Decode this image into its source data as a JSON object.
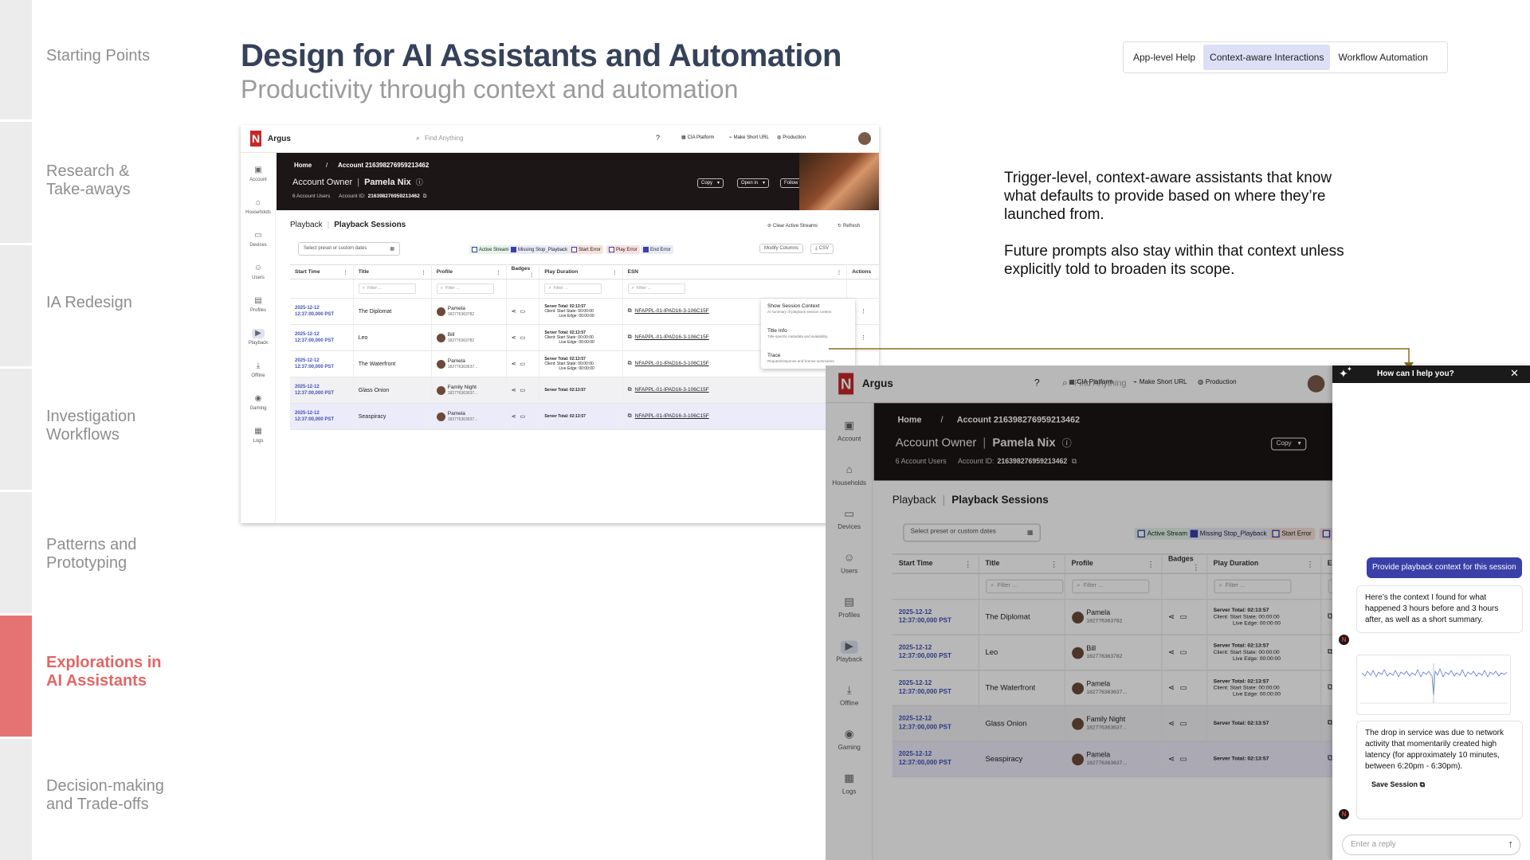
{
  "nav": {
    "items": [
      {
        "label": "Starting Points",
        "active": false
      },
      {
        "label": "Research &\nTake-aways",
        "active": false
      },
      {
        "label": "IA Redesign",
        "active": false
      },
      {
        "label": "Investigation\nWorkflows",
        "active": false
      },
      {
        "label": "Patterns and\nPrototyping",
        "active": false
      },
      {
        "label": "Explorations in\nAI Assistants",
        "active": true
      },
      {
        "label": "Decision-making\nand Trade-offs",
        "active": false
      }
    ]
  },
  "header": {
    "title": "Design for AI Assistants and Automation",
    "subtitle": "Productivity through context and automation"
  },
  "tabs": [
    {
      "label": "App-level Help",
      "selected": false
    },
    {
      "label": "Context-aware Interactions",
      "selected": true
    },
    {
      "label": "Workflow Automation",
      "selected": false
    }
  ],
  "description": [
    "Trigger-level, context-aware assistants that know what defaults to provide based on where they’re launched from.",
    "Future prompts also stay within that context unless explicitly told to broaden its scope."
  ],
  "app": {
    "name": "Argus",
    "logo": "N",
    "search_placeholder": "Find Anything",
    "top_links": [
      "CIA Platform",
      "Make Short URL",
      "Production"
    ],
    "breadcrumb_home": "Home",
    "breadcrumb_sep": "/",
    "breadcrumb_account": "Account 216398276959213462",
    "owner_label": "Account Owner",
    "owner_name": "Pamela Nix",
    "users": "6 Account Users",
    "account_id_label": "Account ID:",
    "account_id": "216398276959213462",
    "btn_copy": "Copy",
    "btn_open": "Open in",
    "btn_follow": "Follow",
    "page_parent": "Playback",
    "page_current": "Playback Sessions",
    "clear_streams": "Clear Active Streams",
    "refresh": "Refresh",
    "date_placeholder": "Select preset or custom dates",
    "chips": [
      "Active Stream",
      "Missing Stop_Playback",
      "Start Error",
      "Play Error",
      "End Error"
    ],
    "modify_columns": "Modify Columns",
    "csv": "CSV",
    "columns": [
      "Start Time",
      "Title",
      "Profile",
      "Badges",
      "Play Duration",
      "ESN",
      "Actions"
    ],
    "filter_placeholder": "Filter ...",
    "sidenav": [
      "Account",
      "Households",
      "Devices",
      "Users",
      "Profiles",
      "Playback",
      "Offline",
      "Gaming",
      "Logs"
    ],
    "rows": [
      {
        "date": "2025-12-12",
        "time": "12:37:00,000 PST",
        "title": "The Diplomat",
        "profile": "Pamela",
        "profile_id": "182776363782",
        "server": "Server Total: 02:13:57",
        "client": "Client: Start State: 00:00:00",
        "live": "Live Edge: 00:00:00",
        "esn": "NFAPPL-01-IPAD16-3-106C15F"
      },
      {
        "date": "2025-12-12",
        "time": "12:37:00,000 PST",
        "title": "Leo",
        "profile": "Bill",
        "profile_id": "182776363782",
        "server": "Server Total: 02:13:57",
        "client": "Client: Start State: 00:00:00",
        "live": "Live Edge: 00:00:00",
        "esn": "NFAPPL-01-IPAD16-3-106C15F"
      },
      {
        "date": "2025-12-12",
        "time": "12:37:00,000 PST",
        "title": "The Waterfront",
        "profile": "Pamela",
        "profile_id": "182776363637...",
        "server": "Server Total: 02:13:57",
        "client": "Client: Start State: 00:00:00",
        "live": "Live Edge: 00:00:00",
        "esn": "NFAPPL-01-IPAD16-3-106C15F"
      },
      {
        "date": "2025-12-12",
        "time": "12:37:00,000 PST",
        "title": "Glass Onion",
        "profile": "Family Night",
        "profile_id": "182776363637...",
        "server": "Server Total: 02:13:57",
        "client": "",
        "live": "",
        "esn": "NFAPPL-01-IPAD16-3-106C15F"
      },
      {
        "date": "2025-12-12",
        "time": "12:37:00,000 PST",
        "title": "Seaspiracy",
        "profile": "Pamela",
        "profile_id": "182776363637...",
        "server": "Server Total: 02:13:57",
        "client": "",
        "live": "",
        "esn": "NFAPPL-01-IPAD16-3-106C15F"
      }
    ],
    "context_menu": [
      {
        "label": "Show Session Context",
        "hint": "AI summary of playback session context"
      },
      {
        "label": "Title Info",
        "hint": "Title-specific metadata and availability"
      },
      {
        "label": "Trace",
        "hint": "Request/response and license summaries"
      }
    ]
  },
  "chat": {
    "title": "How can I help you?",
    "user_message": "Provide playback context for this session",
    "bot_message_1": "Here’s the context I found for what happened 3 hours before and 3 hours after, as well as a short summary.",
    "bot_message_2": "The drop in service was due to network activity that momentarily created high latency (for approximately 10 minutes, between 6:20pm - 6:30pm).",
    "save_session": "Save Session",
    "input_placeholder": "Enter a reply"
  }
}
